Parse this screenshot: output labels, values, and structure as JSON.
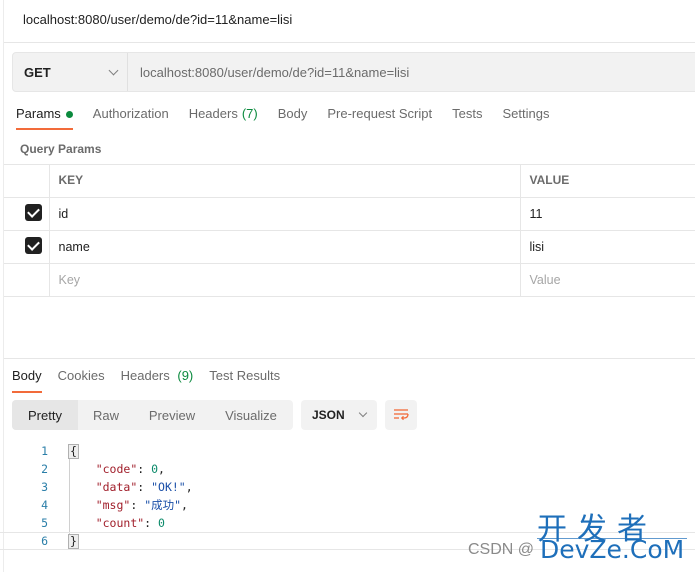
{
  "title": "localhost:8080/user/demo/de?id=11&name=lisi",
  "request": {
    "method": "GET",
    "url": "localhost:8080/user/demo/de?id=11&name=lisi"
  },
  "request_tabs": [
    {
      "label": "Params",
      "active": true,
      "indicator": "green-dot"
    },
    {
      "label": "Authorization"
    },
    {
      "label": "Headers",
      "count": "(7)"
    },
    {
      "label": "Body"
    },
    {
      "label": "Pre-request Script"
    },
    {
      "label": "Tests"
    },
    {
      "label": "Settings"
    }
  ],
  "query_params": {
    "label": "Query Params",
    "columns": {
      "key": "KEY",
      "value": "VALUE"
    },
    "rows": [
      {
        "checked": true,
        "key": "id",
        "value": "11"
      },
      {
        "checked": true,
        "key": "name",
        "value": "lisi"
      }
    ],
    "placeholder": {
      "key": "Key",
      "value": "Value"
    }
  },
  "response_tabs": [
    {
      "label": "Body",
      "active": true
    },
    {
      "label": "Cookies"
    },
    {
      "label": "Headers",
      "count": "(9)"
    },
    {
      "label": "Test Results"
    }
  ],
  "view_modes": [
    "Pretty",
    "Raw",
    "Preview",
    "Visualize"
  ],
  "active_view": "Pretty",
  "format": "JSON",
  "icons": {
    "wrap": "wrap-lines-icon",
    "method_dropdown": "chevron-down-icon"
  },
  "colors": {
    "accent": "#f26b3a",
    "green": "#0b8a3e",
    "key": "#a11f2b",
    "number": "#0b8a6a",
    "string": "#1a4fa8"
  },
  "response_body": {
    "line_numbers": [
      "1",
      "2",
      "3",
      "4",
      "5",
      "6"
    ],
    "lines": [
      {
        "open": "{"
      },
      {
        "key": "\"code\"",
        "sep": ": ",
        "value": "0",
        "type": "number",
        "end": ","
      },
      {
        "key": "\"data\"",
        "sep": ": ",
        "value": "\"OK!\"",
        "type": "string",
        "end": ","
      },
      {
        "key": "\"msg\"",
        "sep": ": ",
        "value": "\"成功\"",
        "type": "string",
        "end": ","
      },
      {
        "key": "\"count\"",
        "sep": ": ",
        "value": "0",
        "type": "number",
        "end": ""
      },
      {
        "close": "}"
      }
    ]
  },
  "watermark": {
    "cn": "开发者",
    "csdn": "CSDN @",
    "devze": "DevZe.CoM"
  }
}
